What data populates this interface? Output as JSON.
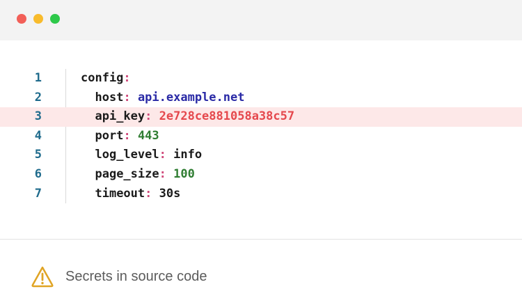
{
  "window": {
    "controls": [
      "close",
      "minimize",
      "maximize"
    ],
    "control_colors": {
      "close": "#f25f58",
      "minimize": "#f8bb2c",
      "maximize": "#2ec94a"
    }
  },
  "editor": {
    "highlight_color": "#fde8e8",
    "lines": [
      {
        "number": "1",
        "key": "config",
        "colon": ":",
        "value": "",
        "value_type": "none"
      },
      {
        "number": "2",
        "key": "host",
        "colon": ":",
        "value": "api.example.net",
        "value_type": "string"
      },
      {
        "number": "3",
        "key": "api_key",
        "colon": ":",
        "value": "2e728ce881058a38c57",
        "value_type": "secret",
        "highlighted": true
      },
      {
        "number": "4",
        "key": "port",
        "colon": ":",
        "value": "443",
        "value_type": "number"
      },
      {
        "number": "5",
        "key": "log_level",
        "colon": ":",
        "value": "info",
        "value_type": "plain"
      },
      {
        "number": "6",
        "key": "page_size",
        "colon": ":",
        "value": "100",
        "value_type": "number"
      },
      {
        "number": "7",
        "key": "timeout",
        "colon": ":",
        "value": "30s",
        "value_type": "plain"
      }
    ]
  },
  "footer": {
    "icon": "warning-icon",
    "icon_color": "#e0a424",
    "text": "Secrets in source code"
  }
}
